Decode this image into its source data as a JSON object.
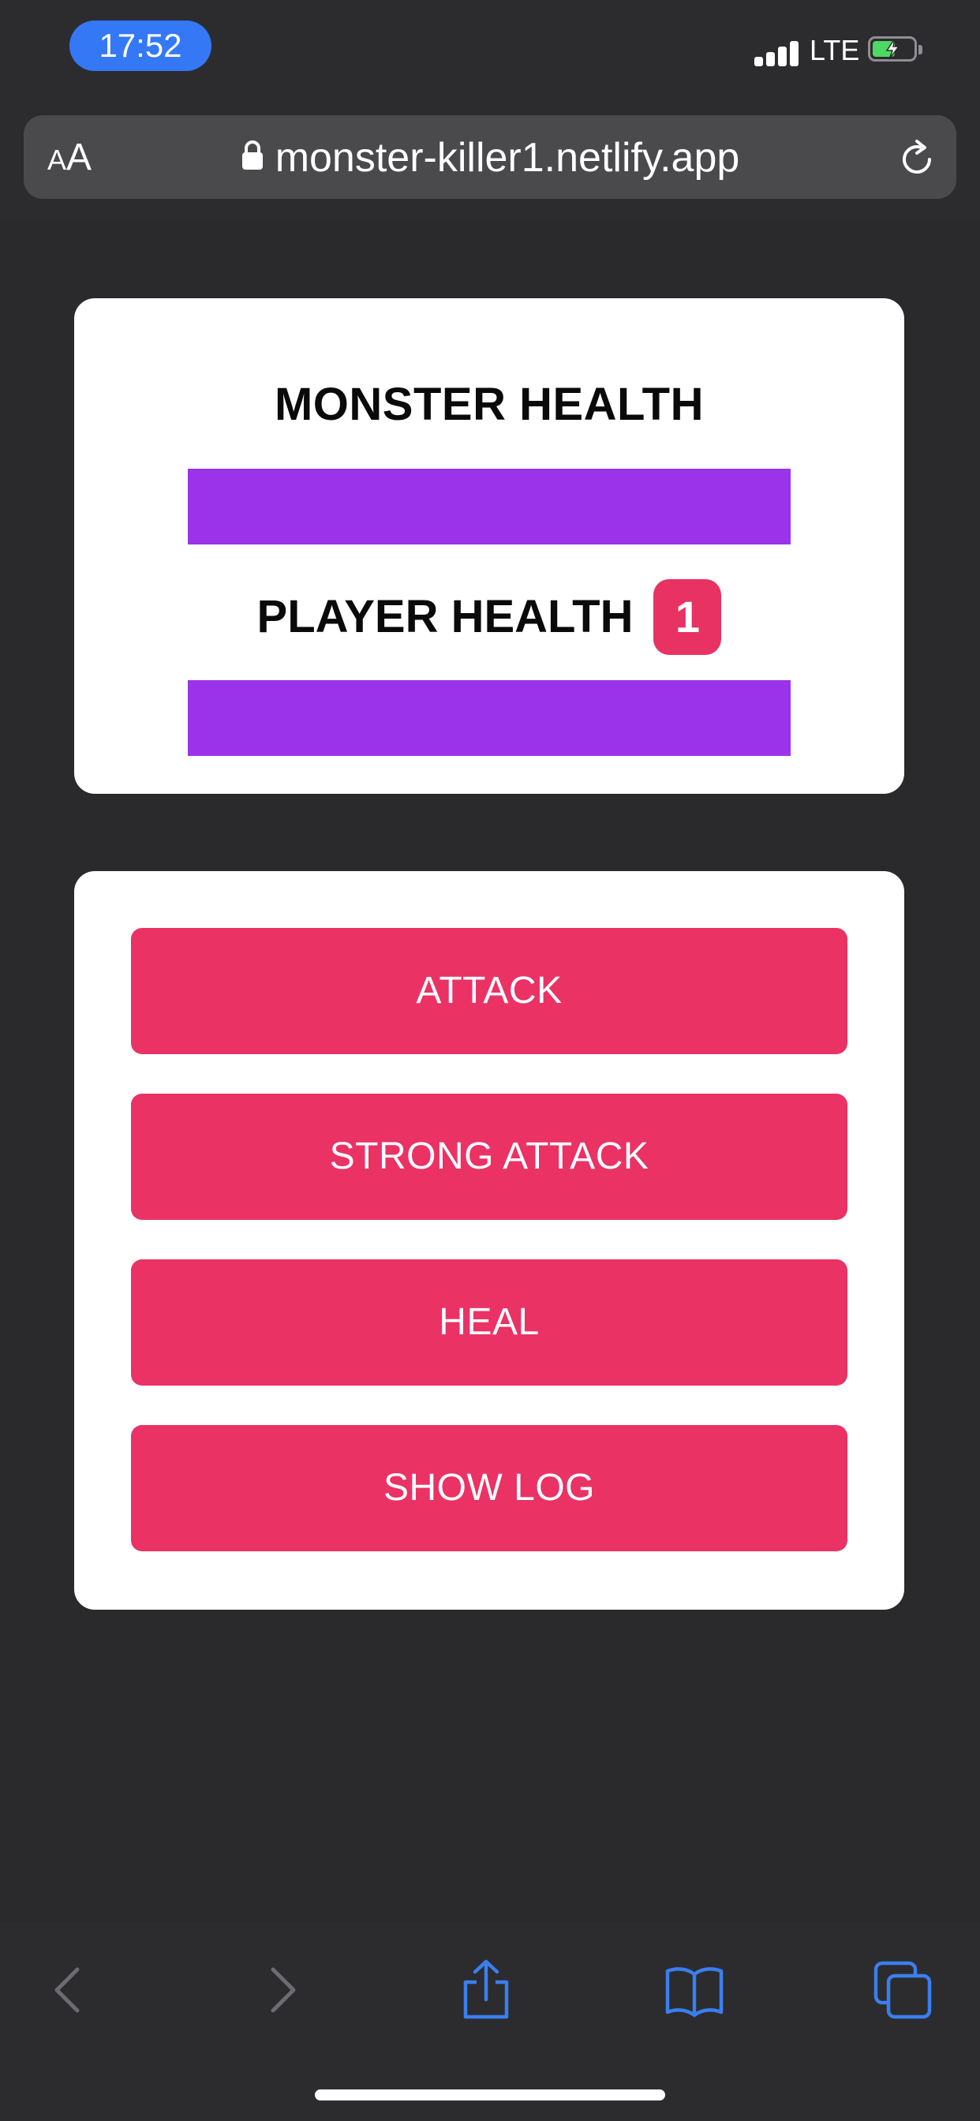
{
  "status_bar": {
    "time": "17:52",
    "network": "LTE",
    "accent_color": "#3478f6"
  },
  "browser": {
    "text_size_label_small": "A",
    "text_size_label_big": "A",
    "url": "monster-killer1.netlify.app",
    "icons": [
      "lock-icon",
      "reload-icon",
      "back-icon",
      "forward-icon",
      "share-icon",
      "bookmarks-icon",
      "tabs-icon"
    ]
  },
  "health": {
    "monster_title": "MONSTER HEALTH",
    "player_title": "PLAYER HEALTH",
    "bonus_lives": "1",
    "monster_health_fraction": 1.0,
    "player_health_fraction": 1.0,
    "bar_color": "#9b33eb"
  },
  "controls": {
    "attack_label": "ATTACK",
    "strong_attack_label": "STRONG ATTACK",
    "heal_label": "HEAL",
    "show_log_label": "SHOW LOG",
    "button_color": "#ea3265"
  }
}
